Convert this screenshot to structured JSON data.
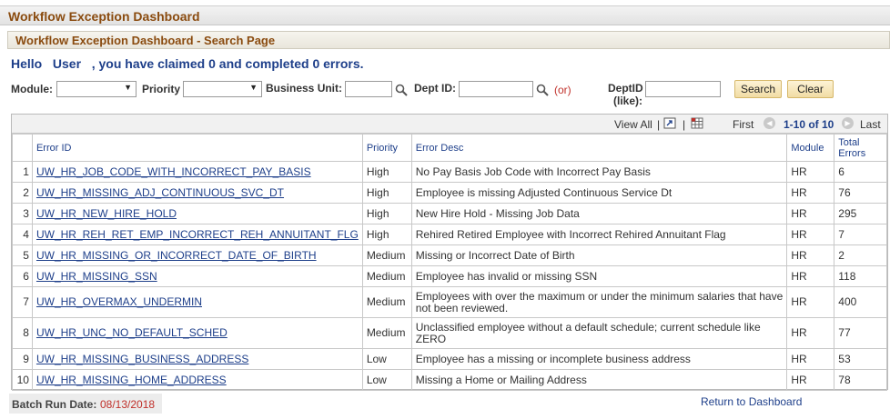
{
  "window": {
    "title": "Workflow Exception Dashboard"
  },
  "page": {
    "subtitle": "Workflow Exception Dashboard - Search Page"
  },
  "greeting": {
    "hello": "Hello",
    "user": "User",
    "message": ", you have claimed 0 and completed 0 errors."
  },
  "filters": {
    "module_label": "Module:",
    "module_value": "",
    "priority_label": "Priority",
    "priority_value": "",
    "business_unit_label": "Business Unit:",
    "business_unit_value": "",
    "dept_id_label": "Dept ID:",
    "dept_id_value": "",
    "or_text": "(or)",
    "deptid_like_label_1": "DeptID",
    "deptid_like_label_2": "(like):",
    "deptid_like_value": "",
    "search_button": "Search",
    "clear_button": "Clear"
  },
  "grid": {
    "view_all": "View All",
    "separator": "|",
    "first": "First",
    "range": "1-10 of 10",
    "last": "Last",
    "columns": [
      "Error ID",
      "Priority",
      "Error Desc",
      "Module",
      "Total Errors"
    ],
    "rows": [
      {
        "n": "1",
        "id": "UW_HR_JOB_CODE_WITH_INCORRECT_PAY_BASIS",
        "priority": "High",
        "desc": "No Pay Basis Job Code with Incorrect Pay Basis",
        "module": "HR",
        "total": "6"
      },
      {
        "n": "2",
        "id": "UW_HR_MISSING_ADJ_CONTINUOUS_SVC_DT",
        "priority": "High",
        "desc": "Employee is missing Adjusted Continuous Service Dt",
        "module": "HR",
        "total": "76"
      },
      {
        "n": "3",
        "id": "UW_HR_NEW_HIRE_HOLD",
        "priority": "High",
        "desc": "New Hire Hold - Missing Job Data",
        "module": "HR",
        "total": "295"
      },
      {
        "n": "4",
        "id": "UW_HR_REH_RET_EMP_INCORRECT_REH_ANNUITANT_FLG",
        "priority": "High",
        "desc": "Rehired Retired Employee with Incorrect Rehired Annuitant Flag",
        "module": "HR",
        "total": "7"
      },
      {
        "n": "5",
        "id": "UW_HR_MISSING_OR_INCORRECT_DATE_OF_BIRTH",
        "priority": "Medium",
        "desc": "Missing or Incorrect Date of Birth",
        "module": "HR",
        "total": "2"
      },
      {
        "n": "6",
        "id": "UW_HR_MISSING_SSN",
        "priority": "Medium",
        "desc": "Employee has invalid or missing SSN",
        "module": "HR",
        "total": "118"
      },
      {
        "n": "7",
        "id": "UW_HR_OVERMAX_UNDERMIN",
        "priority": "Medium",
        "desc": "Employees with over the maximum or under the minimum salaries that have not been reviewed.",
        "module": "HR",
        "total": "400"
      },
      {
        "n": "8",
        "id": "UW_HR_UNC_NO_DEFAULT_SCHED",
        "priority": "Medium",
        "desc": "Unclassified employee without a default schedule; current schedule like ZERO",
        "module": "HR",
        "total": "77"
      },
      {
        "n": "9",
        "id": "UW_HR_MISSING_BUSINESS_ADDRESS",
        "priority": "Low",
        "desc": "Employee has a missing  or incomplete business address",
        "module": "HR",
        "total": "53"
      },
      {
        "n": "10",
        "id": "UW_HR_MISSING_HOME_ADDRESS",
        "priority": "Low",
        "desc": "Missing a Home or Mailing Address",
        "module": "HR",
        "total": "78"
      }
    ]
  },
  "footer": {
    "batch_label": "Batch Run Date:",
    "batch_date": "08/13/2018",
    "return_link": "Return to Dashboard"
  },
  "colors": {
    "title": "#8a4b0f",
    "link": "#1e3f8a",
    "alert": "#c0302a",
    "button": "#f1dca4"
  }
}
